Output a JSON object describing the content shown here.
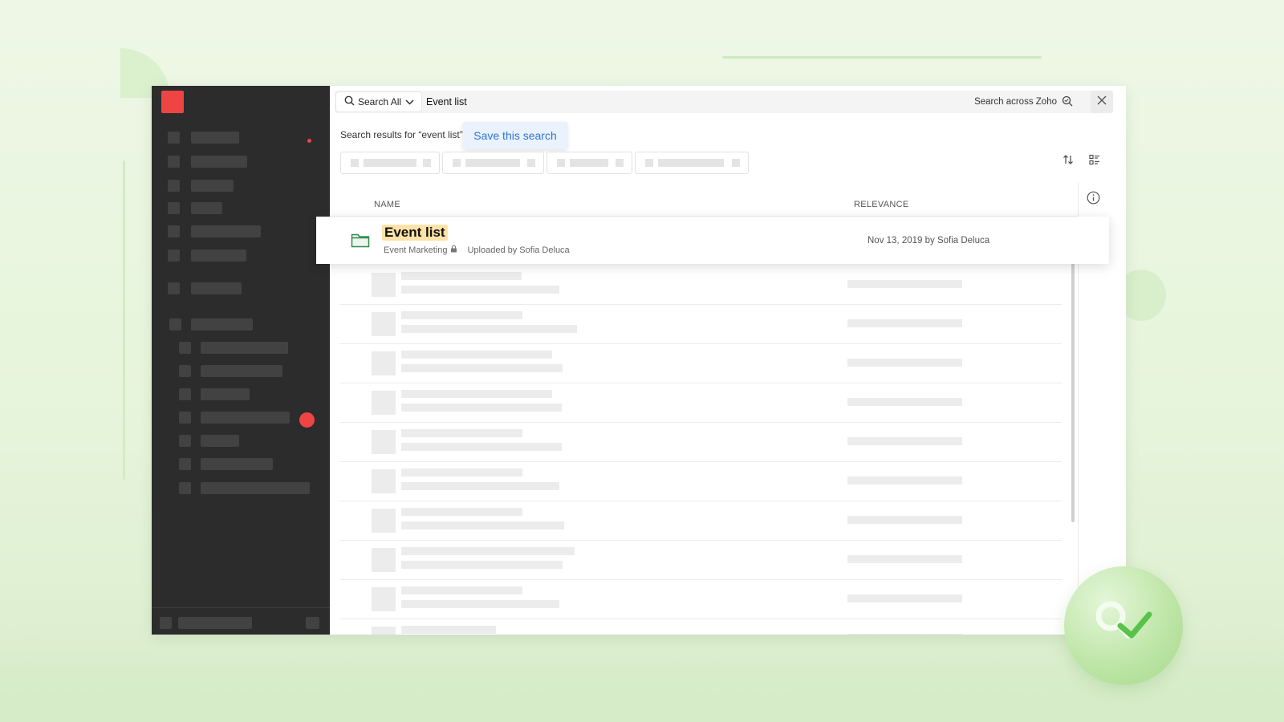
{
  "search": {
    "scope_label": "Search All",
    "query": "Event list",
    "across_label": "Search across Zoho",
    "results_text": "Search results for “event list”",
    "save_label": "Save this search"
  },
  "columns": {
    "name": "NAME",
    "relevance": "RELEVANCE"
  },
  "result": {
    "title": "Event list",
    "folder": "Event Marketing",
    "uploaded": "Uploaded by Sofia Deluca",
    "date": "Nov 13, 2019 by Sofia Deluca"
  },
  "icons": {
    "search": "search-icon",
    "chevron": "chevron-down-icon",
    "zoho_search": "zoho-search-icon",
    "close": "close-icon",
    "sort": "sort-icon",
    "view": "list-view-icon",
    "info": "info-icon",
    "folder": "folder-icon",
    "lock": "lock-icon"
  },
  "colors": {
    "accent": "#ef4444",
    "link": "#2f74d0",
    "highlight": "#fde3a7",
    "folder": "#2e8b4a",
    "sidebar": "#2c2c2c"
  }
}
